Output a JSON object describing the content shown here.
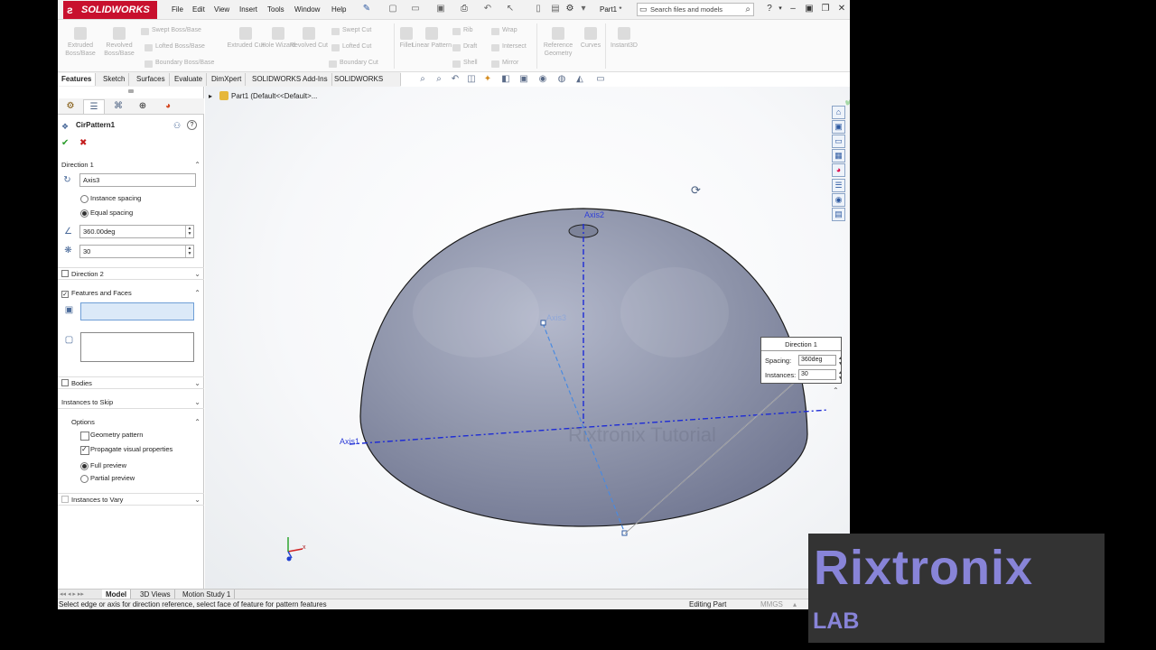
{
  "app": {
    "name": "SOLIDWORKS",
    "doc_title": "Part1 *"
  },
  "menus": [
    "File",
    "Edit",
    "View",
    "Insert",
    "Tools",
    "Window",
    "Help"
  ],
  "search": {
    "placeholder": "Search files and models"
  },
  "ribbon": {
    "large": [
      "Extruded Boss/Base",
      "Revolved Boss/Base",
      "Extruded Cut",
      "Hole Wizard",
      "Revolved Cut",
      "Fillet",
      "Linear Pattern",
      "Reference Geometry",
      "Curves",
      "Instant3D"
    ],
    "small": [
      "Swept Boss/Base",
      "Lofted Boss/Base",
      "Boundary Boss/Base",
      "Swept Cut",
      "Lofted Cut",
      "Boundary Cut",
      "Rib",
      "Draft",
      "Shell",
      "Wrap",
      "Intersect",
      "Mirror"
    ]
  },
  "tabs": [
    "Features",
    "Sketch",
    "Surfaces",
    "Evaluate",
    "DimXpert",
    "SOLIDWORKS Add-Ins",
    "SOLIDWORKS MBD"
  ],
  "tree_root": "Part1  (Default<<Default>...",
  "pm": {
    "title": "CirPattern1",
    "direction1": {
      "label": "Direction 1",
      "axis": "Axis3",
      "instance_spacing": "Instance spacing",
      "equal_spacing": "Equal spacing",
      "angle": "360.00deg",
      "count": "30"
    },
    "direction2": "Direction 2",
    "features_faces": "Features and Faces",
    "bodies": "Bodies",
    "instances_to_skip": "Instances to Skip",
    "options": {
      "label": "Options",
      "geometry_pattern": "Geometry pattern",
      "propagate": "Propagate visual properties",
      "full_preview": "Full preview",
      "partial_preview": "Partial preview"
    },
    "instances_to_vary": "Instances to Vary"
  },
  "viewport": {
    "axis_labels": [
      "Axis2",
      "Axis3",
      "Axis1"
    ],
    "watermark": "Rixtronix Tutorial",
    "callout": {
      "title": "Direction 1",
      "spacing_label": "Spacing:",
      "spacing_value": "360deg",
      "instances_label": "Instances:",
      "instances_value": "30"
    }
  },
  "bottom_tabs": [
    "Model",
    "3D Views",
    "Motion Study 1"
  ],
  "status": {
    "message": "Select edge or axis for direction reference, select face of feature for pattern features",
    "mode": "Editing Part",
    "units": "MMGS"
  },
  "brand": {
    "line1": "Rixtronix",
    "line2": "LAB"
  },
  "colors": {
    "brand_red": "#c8102e",
    "accent_blue": "#2f3fd8",
    "model_gray": "#8c92a8",
    "brand_purple": "#8884d8"
  }
}
